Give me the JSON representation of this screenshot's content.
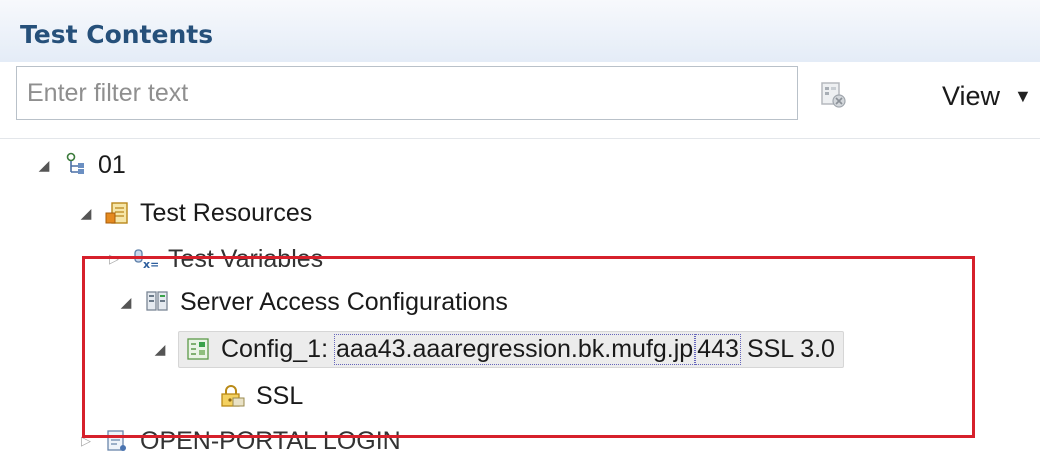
{
  "panel": {
    "title": "Test Contents"
  },
  "filter": {
    "placeholder": "Enter filter text"
  },
  "toolbar": {
    "view_label": "View"
  },
  "tree": {
    "root": "01",
    "test_resources": "Test Resources",
    "test_variables": "Test Variables",
    "server_access": "Server Access Configurations",
    "config_name": "Config_1:",
    "config_host": "aaa43.aaaregression.bk.mufg.jp",
    "config_port": "443",
    "config_ssl": "SSL 3.0",
    "ssl": "SSL",
    "open_portal": "OPEN-PORTAL LOGIN"
  },
  "colors": {
    "title": "#26507a",
    "highlight_box": "#d6202b",
    "selection_bg": "#ececec"
  }
}
